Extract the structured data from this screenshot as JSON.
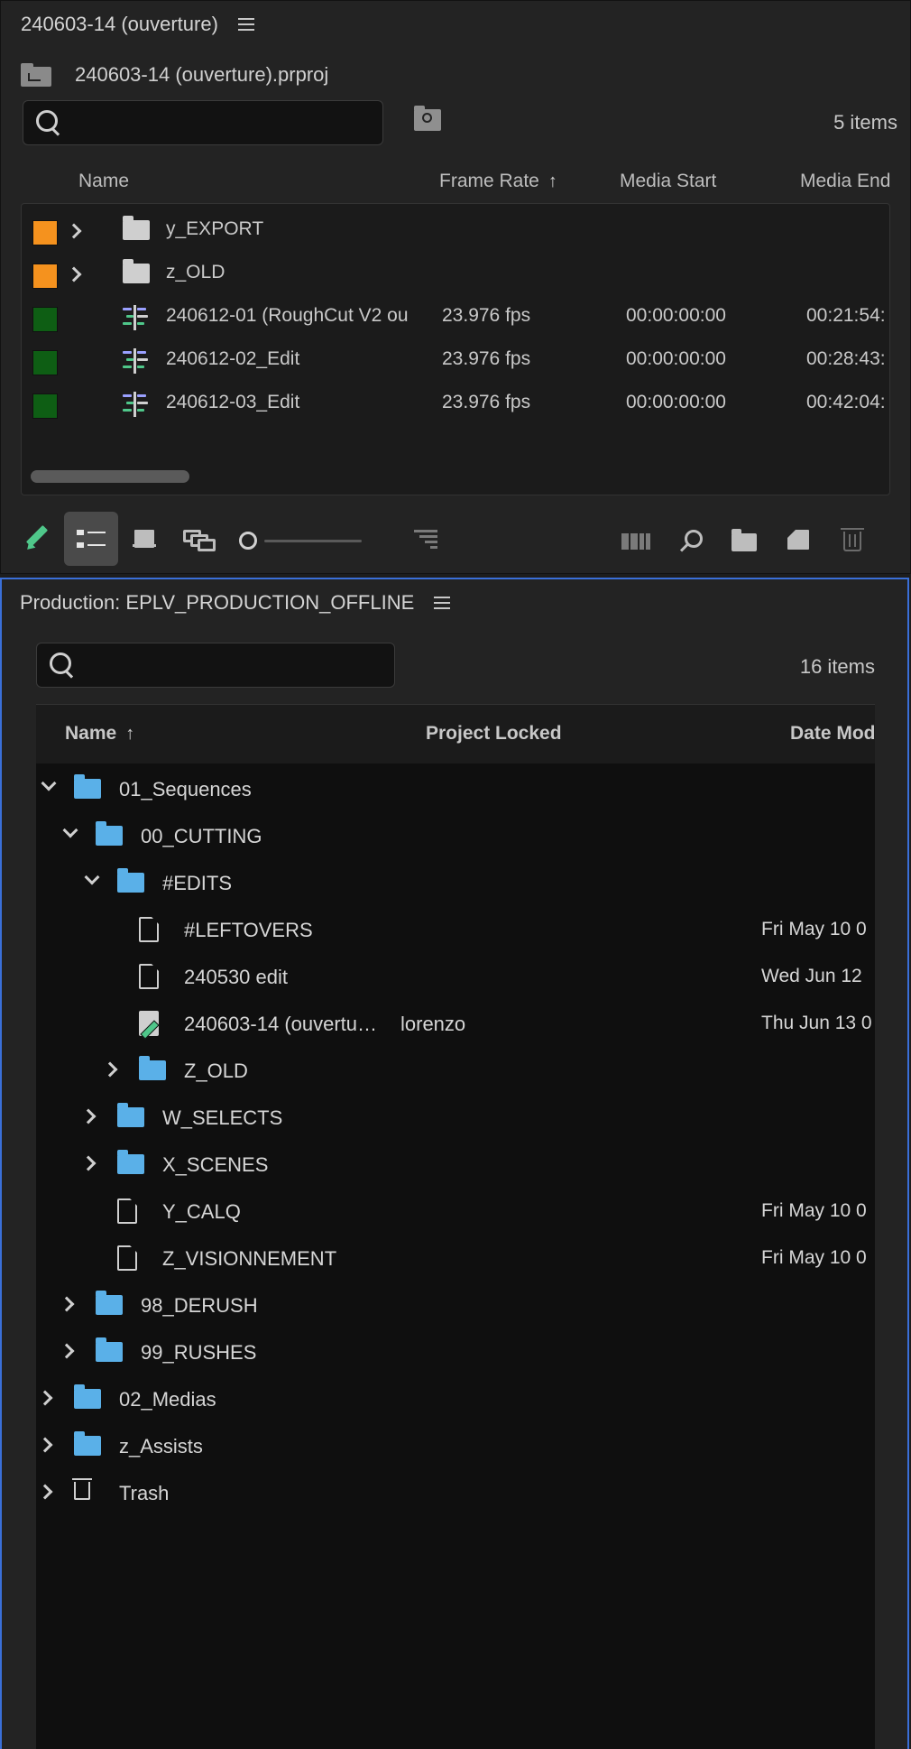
{
  "project_panel": {
    "tab_title": "240603-14 (ouverture)",
    "path": "240603-14 (ouverture).prproj",
    "search": {
      "placeholder": "",
      "value": ""
    },
    "item_count": "5 items",
    "columns": {
      "name": "Name",
      "frame_rate": "Frame Rate",
      "media_start": "Media Start",
      "media_end": "Media End"
    },
    "rows": [
      {
        "label_color": "#f5921e",
        "type": "bin",
        "name": "y_EXPORT",
        "frame_rate": "",
        "media_start": "",
        "media_end": ""
      },
      {
        "label_color": "#f5921e",
        "type": "bin",
        "name": "z_OLD",
        "frame_rate": "",
        "media_start": "",
        "media_end": ""
      },
      {
        "label_color": "#0e5e14",
        "type": "sequence",
        "name": "240612-01 (RoughCut V2 ou",
        "frame_rate": "23.976 fps",
        "media_start": "00:00:00:00",
        "media_end": "00:21:54:"
      },
      {
        "label_color": "#0e5e14",
        "type": "sequence",
        "name": "240612-02_Edit",
        "frame_rate": "23.976 fps",
        "media_start": "00:00:00:00",
        "media_end": "00:28:43:"
      },
      {
        "label_color": "#0e5e14",
        "type": "sequence",
        "name": "240612-03_Edit",
        "frame_rate": "23.976 fps",
        "media_start": "00:00:00:00",
        "media_end": "00:42:04:"
      }
    ],
    "toolbar": {
      "icons": [
        "pencil-icon",
        "list-view-icon",
        "icon-view-icon",
        "freeform-view-icon",
        "zoom-slider",
        "sort-icon",
        "automate-icon",
        "find-icon",
        "new-bin-icon",
        "new-item-icon",
        "trash-icon"
      ],
      "zoom_level": 0.0
    }
  },
  "production_panel": {
    "tab_title": "Production: EPLV_PRODUCTION_OFFLINE",
    "search": {
      "placeholder": "",
      "value": ""
    },
    "item_count": "16 items",
    "columns": {
      "name": "Name",
      "project_locked": "Project Locked",
      "date_modified": "Date Modified"
    },
    "tree": [
      {
        "indent": 0,
        "expand": "open",
        "icon": "folder",
        "name": "01_Sequences",
        "locked": "",
        "date": ""
      },
      {
        "indent": 1,
        "expand": "open",
        "icon": "folder",
        "name": "00_CUTTING",
        "locked": "",
        "date": ""
      },
      {
        "indent": 2,
        "expand": "open",
        "icon": "folder",
        "name": "#EDITS",
        "locked": "",
        "date": ""
      },
      {
        "indent": 3,
        "expand": "none",
        "icon": "project",
        "name": "#LEFTOVERS",
        "locked": "",
        "date": "Fri May 10 0"
      },
      {
        "indent": 3,
        "expand": "none",
        "icon": "project",
        "name": "240530 edit",
        "locked": "",
        "date": "Wed Jun 12"
      },
      {
        "indent": 3,
        "expand": "none",
        "icon": "project-locked",
        "name": "240603-14 (ouvertu…",
        "locked": "lorenzo",
        "date": "Thu Jun 13 0"
      },
      {
        "indent": 3,
        "expand": "closed",
        "icon": "folder",
        "name": "Z_OLD",
        "locked": "",
        "date": ""
      },
      {
        "indent": 2,
        "expand": "closed",
        "icon": "folder",
        "name": "W_SELECTS",
        "locked": "",
        "date": ""
      },
      {
        "indent": 2,
        "expand": "closed",
        "icon": "folder",
        "name": "X_SCENES",
        "locked": "",
        "date": ""
      },
      {
        "indent": 2,
        "expand": "none",
        "icon": "project",
        "name": "Y_CALQ",
        "locked": "",
        "date": "Fri May 10 0"
      },
      {
        "indent": 2,
        "expand": "none",
        "icon": "project",
        "name": "Z_VISIONNEMENT",
        "locked": "",
        "date": "Fri May 10 0"
      },
      {
        "indent": 1,
        "expand": "closed",
        "icon": "folder",
        "name": "98_DERUSH",
        "locked": "",
        "date": ""
      },
      {
        "indent": 1,
        "expand": "closed",
        "icon": "folder",
        "name": "99_RUSHES",
        "locked": "",
        "date": ""
      },
      {
        "indent": 0,
        "expand": "closed",
        "icon": "folder",
        "name": "02_Medias",
        "locked": "",
        "date": ""
      },
      {
        "indent": 0,
        "expand": "closed",
        "icon": "folder",
        "name": "z_Assists",
        "locked": "",
        "date": ""
      },
      {
        "indent": 0,
        "expand": "closed",
        "icon": "trash",
        "name": "Trash",
        "locked": "",
        "date": ""
      }
    ]
  },
  "colors": {
    "accent_focus_border": "#3a6fd8",
    "folder_blue": "#5ab0e8",
    "pencil_green": "#4fc78a"
  }
}
